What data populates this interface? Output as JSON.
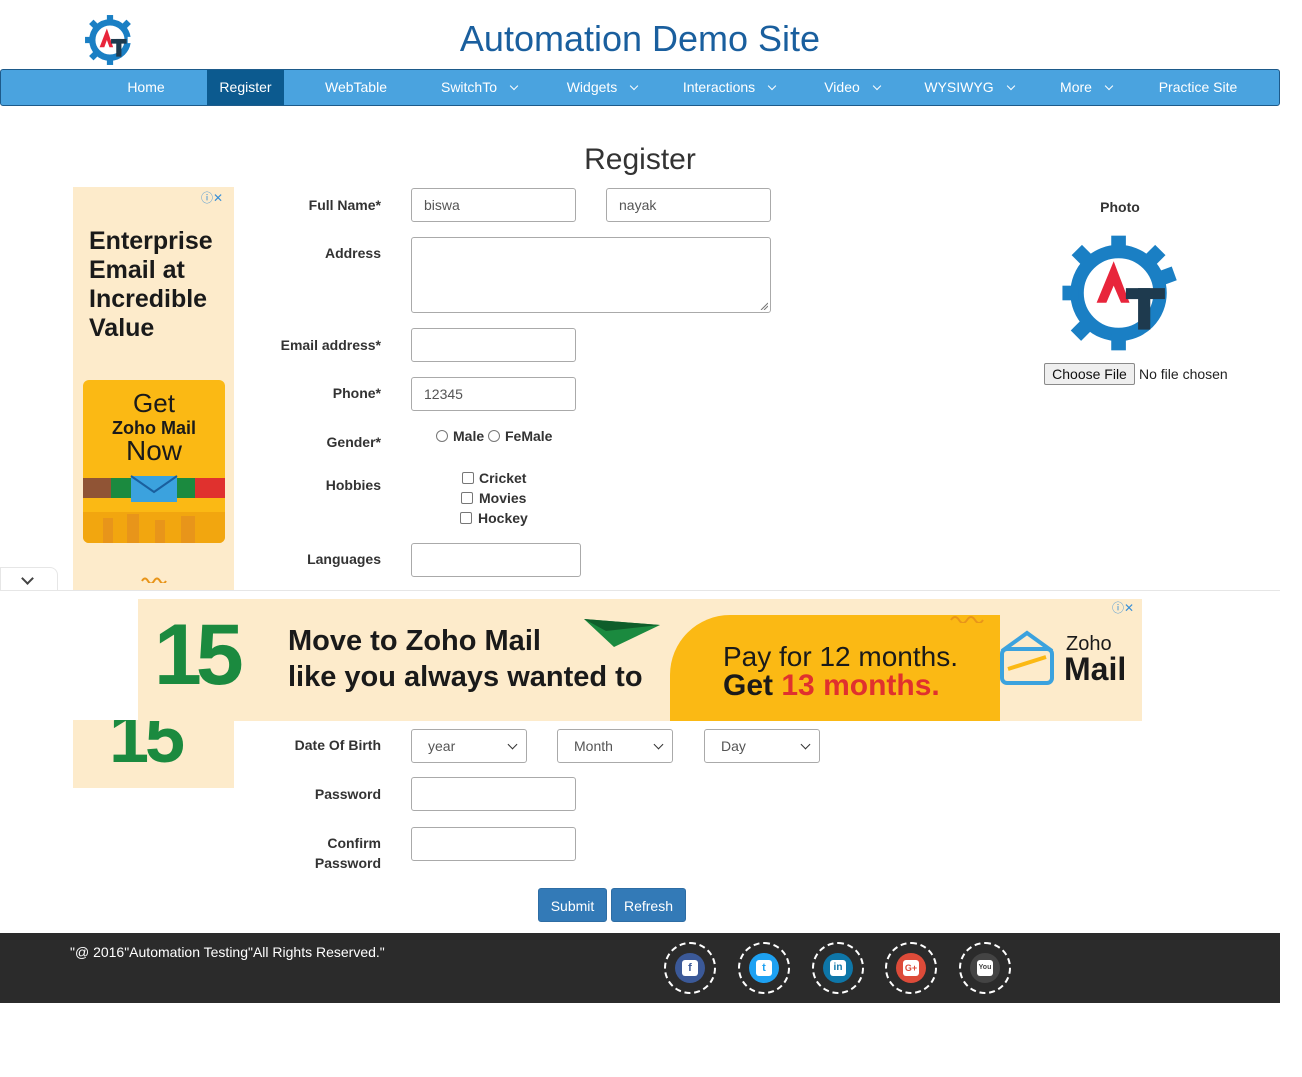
{
  "header": {
    "title": "Automation Demo Site",
    "logo_icon": "automation-testing-gear-logo"
  },
  "nav": {
    "items": [
      {
        "label": "Home",
        "dropdown": false,
        "active": false
      },
      {
        "label": "Register",
        "dropdown": false,
        "active": true
      },
      {
        "label": "WebTable",
        "dropdown": false,
        "active": false
      },
      {
        "label": "SwitchTo",
        "dropdown": true,
        "active": false
      },
      {
        "label": "Widgets",
        "dropdown": true,
        "active": false
      },
      {
        "label": "Interactions",
        "dropdown": true,
        "active": false
      },
      {
        "label": "Video",
        "dropdown": true,
        "active": false
      },
      {
        "label": "WYSIWYG",
        "dropdown": true,
        "active": false
      },
      {
        "label": "More",
        "dropdown": true,
        "active": false
      },
      {
        "label": "Practice Site",
        "dropdown": false,
        "active": false
      }
    ],
    "bg_color": "#4aa3df",
    "active_color": "#0c5a8f"
  },
  "form": {
    "heading": "Register",
    "full_name_label": "Full Name*",
    "first_name_value": "biswa",
    "last_name_value": "nayak",
    "address_label": "Address",
    "address_value": "",
    "email_label": "Email address*",
    "email_value": "",
    "phone_label": "Phone*",
    "phone_value": "12345",
    "gender_label": "Gender*",
    "gender_options": [
      "Male",
      "FeMale"
    ],
    "hobbies_label": "Hobbies",
    "hobbies_options": [
      "Cricket",
      "Movies",
      "Hockey"
    ],
    "languages_label": "Languages",
    "languages_value": "",
    "dob_label": "Date Of Birth",
    "dob_year": "year",
    "dob_month": "Month",
    "dob_day": "Day",
    "password_label": "Password",
    "confirm_password_label_1": "Confirm",
    "confirm_password_label_2": "Password",
    "submit_label": "Submit",
    "refresh_label": "Refresh"
  },
  "photo": {
    "label": "Photo",
    "choose_file": "Choose File",
    "no_file": "No file chosen"
  },
  "footer": {
    "text": "\"@ 2016\"Automation Testing\"All Rights Reserved.\"",
    "social": [
      {
        "name": "facebook-icon",
        "color": "#3b5998",
        "glyph": "f"
      },
      {
        "name": "twitter-icon",
        "color": "#1da1f2",
        "glyph": "t"
      },
      {
        "name": "linkedin-icon",
        "color": "#0e76a8",
        "glyph": "in"
      },
      {
        "name": "google-plus-icon",
        "color": "#dd4b39",
        "glyph": "G+"
      },
      {
        "name": "youtube-icon",
        "color": "#444444",
        "glyph": "You"
      }
    ]
  },
  "side_ad": {
    "headline": [
      "Enterprise",
      "Email at",
      "Incredible",
      "Value"
    ],
    "cta_1": "Get",
    "cta_2": "Zoho Mail",
    "cta_3": "Now",
    "big_number": "15"
  },
  "bottom_ad": {
    "big_number": "15",
    "line1": "Move to Zoho Mail",
    "line2": "like you always wanted to",
    "pay": "Pay for 12 months.",
    "get_prefix": "Get ",
    "get_highlight": "13 months.",
    "brand_1": "Zoho",
    "brand_2": "Mail"
  }
}
